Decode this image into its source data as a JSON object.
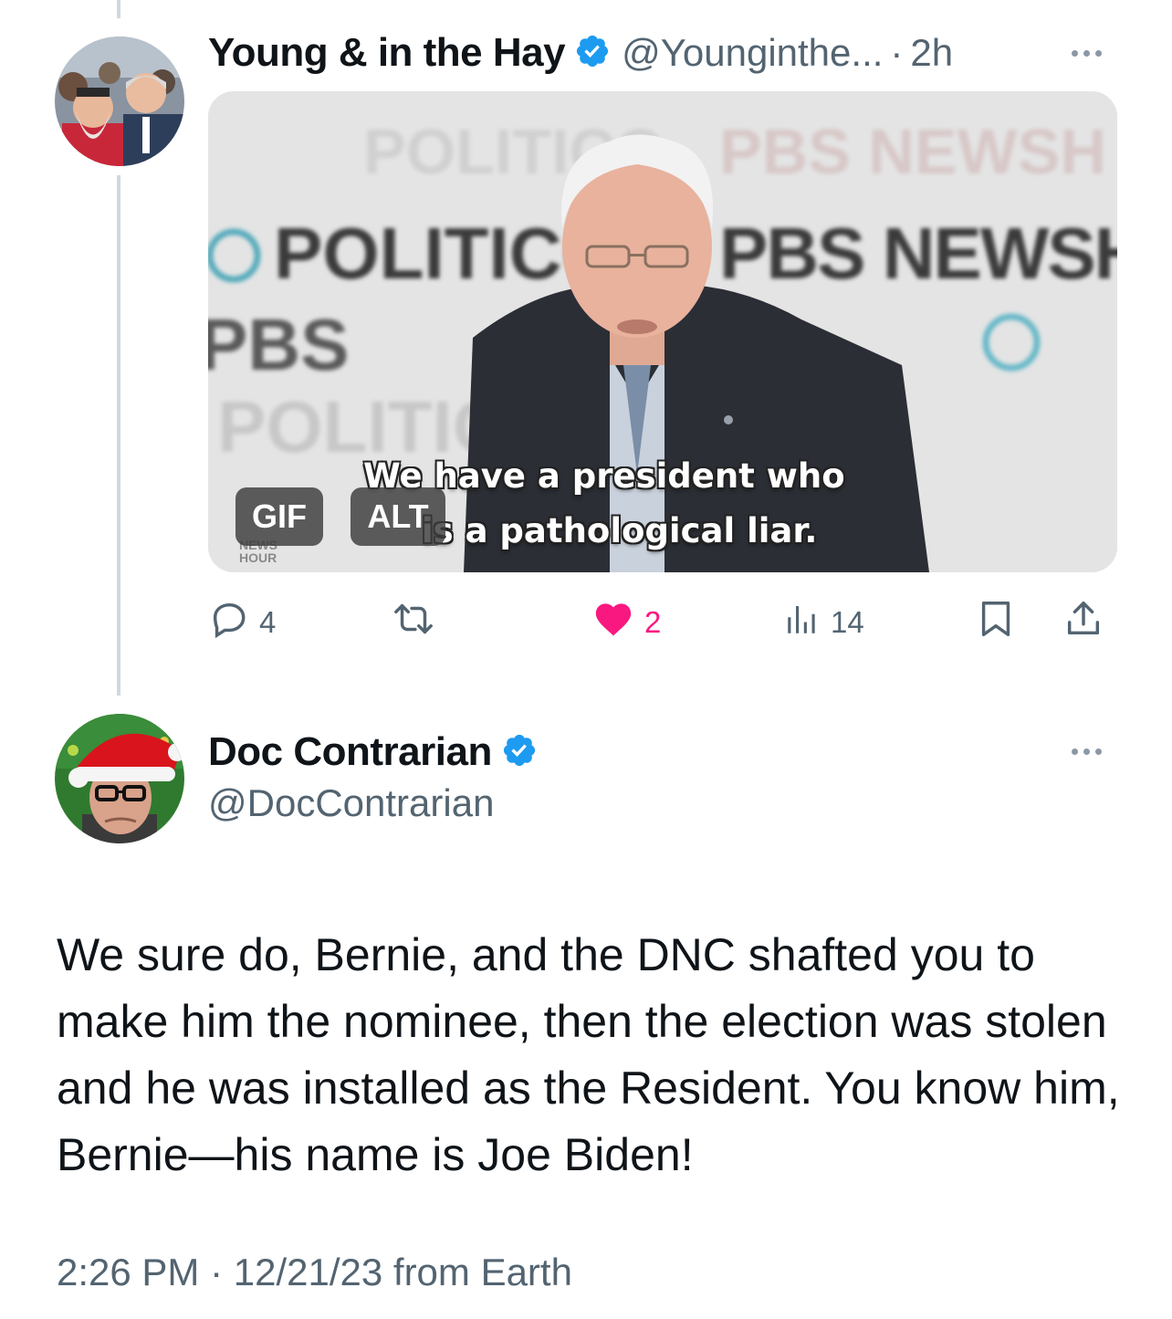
{
  "colors": {
    "verified": "#1d9bf0",
    "like": "#f91880",
    "secondary_text": "#536471",
    "thread_line": "#cfd9de"
  },
  "tweet1": {
    "display_name": "Young & in the Hay",
    "handle": "@Younginthe...",
    "separator": "·",
    "time": "2h",
    "verified_icon": "verified-badge-icon",
    "media": {
      "badge_gif": "GIF",
      "badge_alt": "ALT",
      "caption_line1": "We have a president who",
      "caption_line2": "is a pathological liar.",
      "backdrop_text_1": "POLITICO",
      "backdrop_text_2": "PBS NEWSH",
      "backdrop_text_3": "PBS",
      "backdrop_text_4": "NEWS HOUR"
    },
    "actions": {
      "replies": "4",
      "reposts": "",
      "likes": "2",
      "views": "14"
    }
  },
  "tweet2": {
    "display_name": "Doc Contrarian",
    "handle": "@DocContrarian",
    "verified_icon": "verified-badge-icon",
    "text": "We sure do, Bernie, and the DNC shafted you to make him the nominee, then the election was stolen and he was installed as the Resident. You know him, Bernie—his name is Joe Biden!",
    "timestamp": "2:26 PM · 12/21/23 from Earth"
  }
}
